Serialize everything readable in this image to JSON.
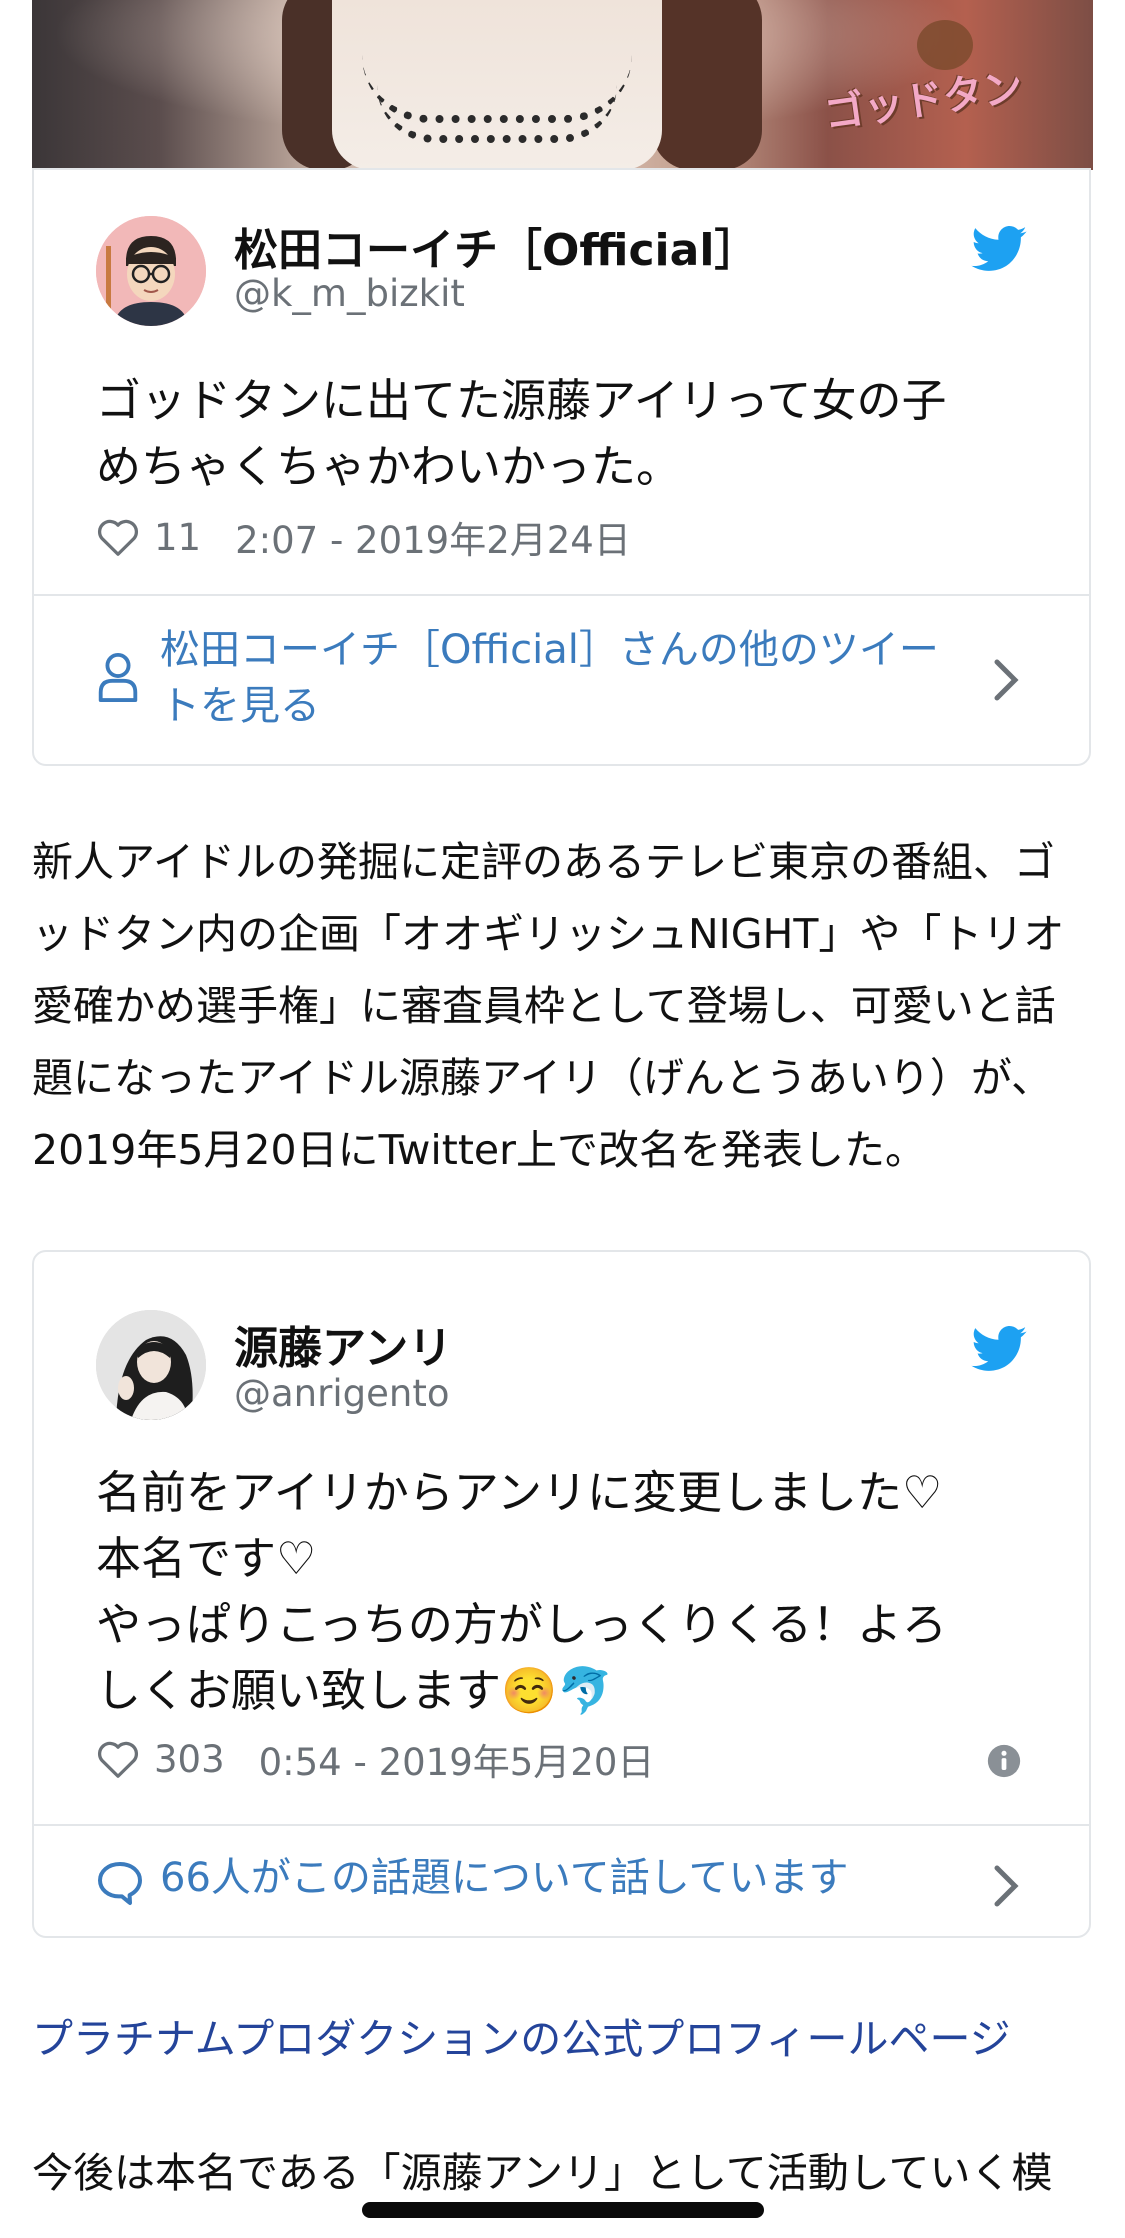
{
  "hero": {
    "logo_text": "ゴッドタン"
  },
  "tweet1": {
    "name": "松田コーイチ［Official］",
    "handle": "@k_m_bizkit",
    "text_lines": [
      "ゴッドタンに出てた源藤アイリって女の子",
      "めちゃくちゃかわいかった。"
    ],
    "likes": "11",
    "timestamp": "2:07 - 2019年2月24日",
    "more_link": "松田コーイチ［Official］さんの他のツイートを見る"
  },
  "article": {
    "paragraph1": "新人アイドルの発掘に定評のあるテレビ東京の番組、ゴッドタン内の企画「オオギリッシュNIGHT」や「トリオ愛確かめ選手権」に審査員枠として登場し、可愛いと話題になったアイドル源藤アイリ（げんとうあいり）が、2019年5月20日にTwitter上で改名を発表した。",
    "link": "プラチナムプロダクションの公式プロフィールページ",
    "paragraph2": "今後は本名である「源藤アンリ」として活動していく模"
  },
  "tweet2": {
    "name": "源藤アンリ",
    "handle": "@anrigento",
    "text_lines": [
      "名前をアイリからアンリに変更しました♡",
      "本名です♡",
      "やっぱりこっちの方がしっくりくる！よろ",
      "しくお願い致します☺️🐬"
    ],
    "likes": "303",
    "timestamp": "0:54 - 2019年5月20日",
    "conversation_link": "66人がこの話題について話しています"
  },
  "colors": {
    "twitter_blue": "#1da1f2",
    "link_blue": "#3b7bbd",
    "article_link": "#24449a"
  }
}
